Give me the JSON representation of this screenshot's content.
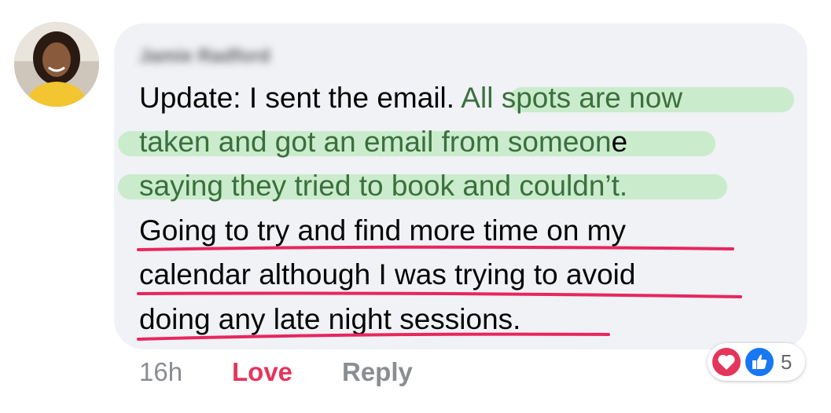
{
  "comment": {
    "author": "Jamie Radford",
    "lines": [
      {
        "plain": "Update: I sent the email. ",
        "highlighted": "All spots are now"
      },
      {
        "highlighted": "taken and got an email from someon",
        "plain": "e"
      },
      {
        "highlighted": "saying they tried to book and couldn’t."
      },
      {
        "plain": "Going to try and find more time on my"
      },
      {
        "plain": "calendar although I was trying to avoid"
      },
      {
        "plain": "doing any late night sessions."
      }
    ]
  },
  "actions": {
    "time": "16h",
    "love": "Love",
    "reply": "Reply"
  },
  "reactions": {
    "icons": [
      "heart-icon",
      "thumbs-up-icon"
    ],
    "count": "5"
  },
  "colors": {
    "love": "#e4355b",
    "like": "#1877f2",
    "highlight": "#96e496",
    "underline": "#e8265e"
  }
}
